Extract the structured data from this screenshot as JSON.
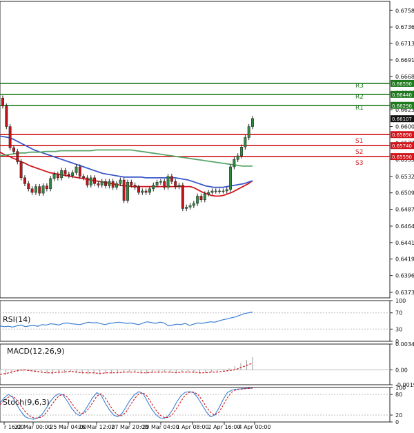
{
  "chart_data": [
    {
      "type": "candlestick",
      "panel": "price",
      "y_ticks": [
        "0.67585",
        "0.67360",
        "0.67135",
        "0.66910",
        "0.66685",
        "0.66460",
        "0.66230",
        "0.66000",
        "0.65775",
        "0.65550",
        "0.65320",
        "0.65095",
        "0.64870",
        "0.64640",
        "0.64415",
        "0.64190",
        "0.63965",
        "0.63735"
      ],
      "ylim": [
        0.6366,
        0.6771
      ],
      "x_ticks": [
        "r 16:00",
        "22 Mar 00:00",
        "25 Mar 04:00",
        "26 Mar 12:00",
        "27 Mar 20:00",
        "29 Mar 04:00",
        "1 Apr 08:00",
        "2 Apr 16:00",
        "4 Apr 00:00"
      ],
      "last_price": "0.66107",
      "levels": [
        {
          "name": "R3",
          "value": 0.6659,
          "label": "0.66590",
          "color": "#1f7a1f"
        },
        {
          "name": "R2",
          "value": 0.6644,
          "label": "0.66440",
          "color": "#1f7a1f"
        },
        {
          "name": "R1",
          "value": 0.6629,
          "label": "0.66290",
          "color": "#1f7a1f"
        },
        {
          "name": "S1",
          "value": 0.6589,
          "label": "0.65890",
          "color": "#d0161c"
        },
        {
          "name": "S2",
          "value": 0.6574,
          "label": "0.65740",
          "color": "#d0161c"
        },
        {
          "name": "S3",
          "value": 0.6559,
          "label": "0.65590",
          "color": "#d0161c"
        }
      ],
      "candles_close": [
        0.6628,
        0.66,
        0.6571,
        0.6566,
        0.6552,
        0.653,
        0.6522,
        0.6515,
        0.651,
        0.6518,
        0.6509,
        0.6519,
        0.6515,
        0.6529,
        0.6535,
        0.653,
        0.654,
        0.6535,
        0.6533,
        0.6537,
        0.6545,
        0.6532,
        0.653,
        0.652,
        0.653,
        0.6522,
        0.652,
        0.6525,
        0.6519,
        0.6525,
        0.6517,
        0.6522,
        0.6527,
        0.6499,
        0.6524,
        0.652,
        0.6517,
        0.651,
        0.6512,
        0.651,
        0.6515,
        0.652,
        0.6524,
        0.6525,
        0.6517,
        0.6532,
        0.6525,
        0.6518,
        0.652,
        0.6488,
        0.649,
        0.6492,
        0.6495,
        0.6505,
        0.65,
        0.6508,
        0.651,
        0.6512,
        0.6512,
        0.6512,
        0.6512,
        0.6514,
        0.6545,
        0.6555,
        0.656,
        0.6572,
        0.6585,
        0.66,
        0.6611
      ],
      "candles_open": [
        0.6639,
        0.6628,
        0.66,
        0.6571,
        0.6566,
        0.6552,
        0.653,
        0.6522,
        0.6515,
        0.651,
        0.6518,
        0.6509,
        0.6519,
        0.6515,
        0.6529,
        0.6535,
        0.653,
        0.654,
        0.6535,
        0.6533,
        0.6537,
        0.6545,
        0.6532,
        0.653,
        0.652,
        0.653,
        0.6522,
        0.652,
        0.6525,
        0.6519,
        0.6525,
        0.6517,
        0.6522,
        0.6527,
        0.6499,
        0.6524,
        0.652,
        0.6517,
        0.651,
        0.6512,
        0.651,
        0.6515,
        0.652,
        0.6524,
        0.6525,
        0.6517,
        0.6532,
        0.6525,
        0.6518,
        0.652,
        0.6488,
        0.649,
        0.6492,
        0.6495,
        0.6505,
        0.65,
        0.6508,
        0.651,
        0.6512,
        0.6512,
        0.6512,
        0.6512,
        0.6514,
        0.6545,
        0.6555,
        0.656,
        0.6572,
        0.6585,
        0.66
      ],
      "moving_averages": [
        {
          "color": "#d0161c",
          "values": [
            0.6565,
            0.6562,
            0.656,
            0.6557,
            0.6555,
            0.6552,
            0.655,
            0.6547,
            0.6545,
            0.6543,
            0.6541,
            0.6539,
            0.6537,
            0.6536,
            0.6535,
            0.6534,
            0.6533,
            0.6532,
            0.6531,
            0.653,
            0.6529,
            0.6528,
            0.6527,
            0.6526,
            0.6525,
            0.6524,
            0.6523,
            0.6522,
            0.6521,
            0.652,
            0.6519,
            0.6519,
            0.6518,
            0.6518,
            0.6518,
            0.6518,
            0.6518,
            0.6518,
            0.6518,
            0.6518,
            0.6518,
            0.6518,
            0.6518,
            0.6518,
            0.6518,
            0.6518,
            0.6518,
            0.6516,
            0.6513,
            0.651,
            0.6508,
            0.6506,
            0.6505,
            0.6505,
            0.6506,
            0.6508,
            0.651,
            0.6513,
            0.6516,
            0.6519,
            0.6522,
            0.6526
          ]
        },
        {
          "color": "#3a57c8",
          "values": [
            0.6587,
            0.6586,
            0.6585,
            0.6583,
            0.658,
            0.6577,
            0.6574,
            0.6571,
            0.6568,
            0.6566,
            0.6564,
            0.6562,
            0.656,
            0.6558,
            0.6556,
            0.6554,
            0.6552,
            0.655,
            0.6548,
            0.6546,
            0.6544,
            0.6542,
            0.654,
            0.6538,
            0.6536,
            0.6535,
            0.6534,
            0.6533,
            0.6532,
            0.6531,
            0.6531,
            0.6531,
            0.6531,
            0.6531,
            0.653,
            0.653,
            0.653,
            0.653,
            0.653,
            0.653,
            0.653,
            0.653,
            0.6529,
            0.6528,
            0.6527,
            0.6525,
            0.6523,
            0.6521,
            0.6519,
            0.6518,
            0.6517,
            0.6517,
            0.6517,
            0.6518,
            0.6519,
            0.652,
            0.6521,
            0.6522,
            0.6524,
            0.6526
          ]
        },
        {
          "color": "#5aa66a",
          "values": [
            0.656,
            0.6561,
            0.6562,
            0.6563,
            0.6564,
            0.6564,
            0.6565,
            0.6565,
            0.6565,
            0.6566,
            0.6566,
            0.6566,
            0.6567,
            0.6567,
            0.6567,
            0.6567,
            0.6567,
            0.6567,
            0.6567,
            0.6568,
            0.6568,
            0.6568,
            0.6568,
            0.6568,
            0.6568,
            0.6568,
            0.6568,
            0.6567,
            0.6566,
            0.6565,
            0.6564,
            0.6563,
            0.6562,
            0.6561,
            0.656,
            0.6559,
            0.6558,
            0.6557,
            0.6556,
            0.6555,
            0.6554,
            0.6553,
            0.6552,
            0.6551,
            0.655,
            0.6549,
            0.6548,
            0.6547,
            0.6546,
            0.6546,
            0.6546
          ]
        }
      ]
    },
    {
      "type": "line",
      "panel": "rsi",
      "label": "RSI(14)",
      "y_ticks": [
        "100",
        "70",
        "30",
        "0"
      ],
      "ylim": [
        0,
        100
      ],
      "values": [
        38,
        36,
        37,
        35,
        38,
        40,
        36,
        38,
        39,
        37,
        41,
        40,
        43,
        42,
        40,
        44,
        45,
        43,
        42,
        41,
        44,
        47,
        45,
        46,
        43,
        41,
        44,
        45,
        47,
        46,
        44,
        45,
        43,
        41,
        45,
        48,
        46,
        44,
        47,
        45,
        38,
        40,
        42,
        41,
        44,
        39,
        42,
        45,
        44,
        46,
        48,
        47,
        50,
        53,
        55,
        58,
        60,
        64,
        68,
        70,
        72
      ]
    },
    {
      "type": "line",
      "panel": "macd",
      "label": "MACD(12,26,9)",
      "y_ticks": [
        "0.003453",
        "0.00",
        "-0.001999"
      ],
      "ylim": [
        -0.001999,
        0.003453
      ],
      "signal": [
        -0.0006,
        -0.0005,
        -0.0003,
        -0.0001,
        0.0,
        -0.0001,
        -0.0002,
        -0.0003,
        -0.0004,
        -0.0004,
        -0.0003,
        -0.0003,
        -0.0002,
        -0.0003,
        -0.0004,
        -0.0004,
        -0.0004,
        -0.0005,
        -0.0004,
        -0.0004,
        -0.0004,
        -0.0003,
        -0.0003,
        -0.0003,
        -0.0004,
        -0.0004,
        -0.0003,
        -0.0003,
        -0.0003,
        -0.0003,
        -0.0004,
        -0.0003,
        -0.0003,
        -0.0003,
        -0.0004,
        -0.0004,
        -0.0003,
        -0.0003,
        -0.0002,
        -0.0001,
        0.0,
        0.0003,
        0.0006,
        0.0009
      ],
      "histogram": [
        -0.0009,
        -0.0007,
        -0.0005,
        -0.0003,
        -0.0002,
        -0.0001,
        -0.0002,
        -0.0004,
        -0.0005,
        -0.0006,
        -0.0005,
        -0.0004,
        -0.0003,
        -0.0004,
        -0.0005,
        -0.0006,
        -0.0006,
        -0.0006,
        -0.0005,
        -0.0005,
        -0.0004,
        -0.0004,
        -0.0003,
        -0.0003,
        -0.0004,
        -0.0005,
        -0.0004,
        -0.0004,
        -0.0003,
        -0.0004,
        -0.0004,
        -0.0003,
        -0.0003,
        -0.0004,
        -0.0005,
        -0.0004,
        -0.0003,
        -0.0002,
        -0.0001,
        0.0002,
        0.0005,
        0.0009,
        0.0013,
        0.0017
      ]
    },
    {
      "type": "line",
      "panel": "stoch",
      "label": "Stoch(9,6,3)",
      "y_ticks": [
        "100",
        "80",
        "20",
        "0"
      ],
      "ylim": [
        0,
        100
      ],
      "k": [
        55,
        70,
        80,
        72,
        50,
        30,
        15,
        10,
        8,
        12,
        22,
        40,
        60,
        75,
        82,
        78,
        60,
        40,
        25,
        18,
        30,
        50,
        70,
        85,
        78,
        55,
        35,
        20,
        15,
        25,
        45,
        65,
        80,
        88,
        82,
        60,
        38,
        22,
        12,
        10,
        18,
        35,
        58,
        76,
        86,
        88,
        85,
        70,
        50,
        30,
        15,
        20,
        40,
        65,
        85,
        92,
        95,
        96,
        97,
        98,
        98
      ],
      "d": [
        50,
        62,
        72,
        75,
        64,
        46,
        30,
        18,
        12,
        11,
        15,
        27,
        45,
        62,
        76,
        80,
        72,
        55,
        38,
        25,
        25,
        38,
        56,
        75,
        82,
        70,
        50,
        32,
        20,
        18,
        30,
        50,
        68,
        82,
        85,
        74,
        54,
        35,
        20,
        13,
        13,
        22,
        40,
        60,
        78,
        86,
        87,
        80,
        64,
        44,
        28,
        20,
        28,
        48,
        70,
        86,
        93,
        95,
        96,
        97,
        98
      ]
    }
  ]
}
